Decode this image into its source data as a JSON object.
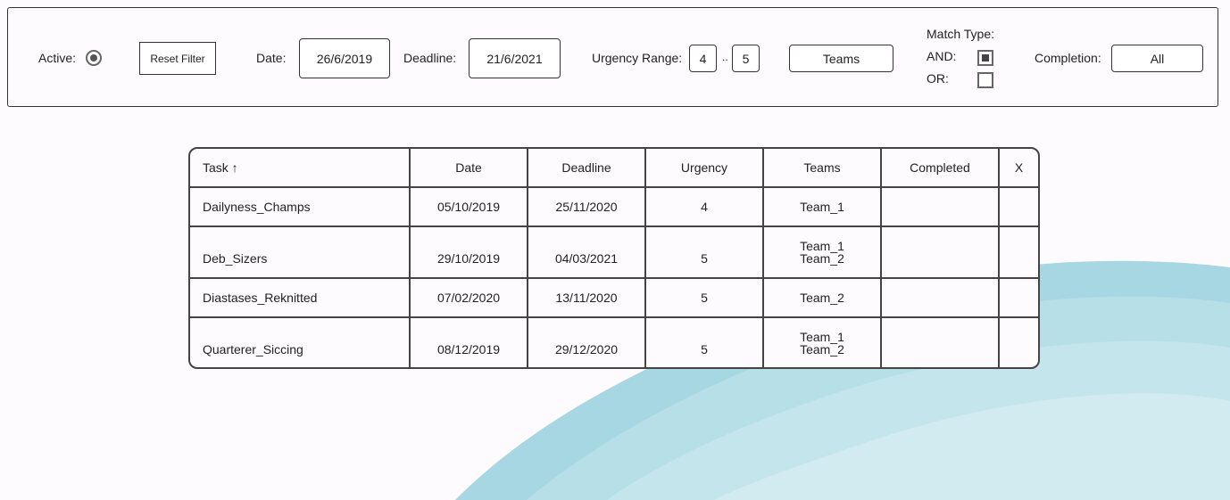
{
  "filter": {
    "active_label": "Active:",
    "reset_label": "Reset Filter",
    "date_label": "Date:",
    "date_value": "26/6/2019",
    "deadline_label": "Deadline:",
    "deadline_value": "21/6/2021",
    "urgency_label": "Urgency Range:",
    "urgency_min": "4",
    "urgency_sep": "..",
    "urgency_max": "5",
    "teams_label": "Teams",
    "match_type_label": "Match Type:",
    "and_label": "AND:",
    "or_label": "OR:",
    "completion_label": "Completion:",
    "completion_value": "All",
    "active_selected": true,
    "and_checked": true,
    "or_checked": false
  },
  "table": {
    "headers": {
      "task": "Task ↑",
      "date": "Date",
      "deadline": "Deadline",
      "urgency": "Urgency",
      "teams": "Teams",
      "completed": "Completed",
      "x": "X"
    },
    "rows": [
      {
        "task": "Dailyness_Champs",
        "date": "05/10/2019",
        "deadline": "25/11/2020",
        "urgency": "4",
        "team1": "Team_1",
        "team2": ""
      },
      {
        "task": "Deb_Sizers",
        "date": "29/10/2019",
        "deadline": "04/03/2021",
        "urgency": "5",
        "team1": "Team_1",
        "team2": "Team_2"
      },
      {
        "task": "Diastases_Reknitted",
        "date": "07/02/2020",
        "deadline": "13/11/2020",
        "urgency": "5",
        "team1": "Team_2",
        "team2": ""
      },
      {
        "task": "Quarterer_Siccing",
        "date": "08/12/2019",
        "deadline": "29/12/2020",
        "urgency": "5",
        "team1": "Team_1",
        "team2": "Team_2"
      }
    ]
  },
  "colors": {
    "wave": "#a9d9e3",
    "background": "#fdfbfd"
  }
}
